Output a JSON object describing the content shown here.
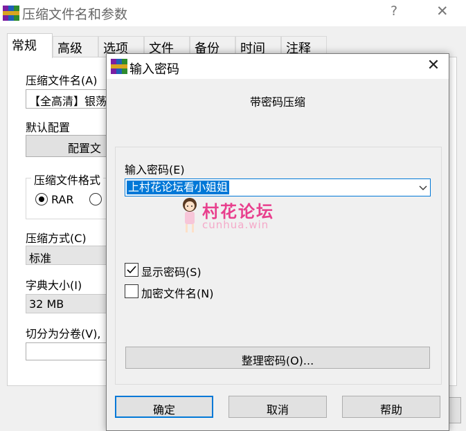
{
  "background_window": {
    "title": "压缩文件名和参数",
    "help_glyph": "?",
    "close_glyph": "✕",
    "tabs": [
      "常规",
      "高级",
      "选项",
      "文件",
      "备份",
      "时间",
      "注释"
    ],
    "active_tab": "常规",
    "general": {
      "archive_name_label": "压缩文件名(A)",
      "archive_name_value": "【全高清】银荡",
      "default_profile_label": "默认配置",
      "profile_button": "配置文",
      "format_group_label": "压缩文件格式",
      "format_option_rar": "RAR",
      "method_label": "压缩方式(C)",
      "method_value": "标准",
      "dict_label": "字典大小(I)",
      "dict_value": "32 MB",
      "split_label": "切分为分卷(V),"
    }
  },
  "dialog": {
    "title": "输入密码",
    "close_glyph": "✕",
    "heading": "带密码压缩",
    "password_label": "输入密码(E)",
    "password_value": "上村花论坛看小姐姐",
    "show_password_label": "显示密码(S)",
    "show_password_checked": true,
    "encrypt_names_label": "加密文件名(N)",
    "encrypt_names_checked": false,
    "organize_button": "整理密码(O)...",
    "ok_button": "确定",
    "cancel_button": "取消",
    "help_button": "帮助"
  },
  "watermark": {
    "title": "村花论坛",
    "subtitle": "cunhua.win"
  },
  "colors": {
    "accent": "#0078d7",
    "watermark_pink": "#e83f8d"
  }
}
